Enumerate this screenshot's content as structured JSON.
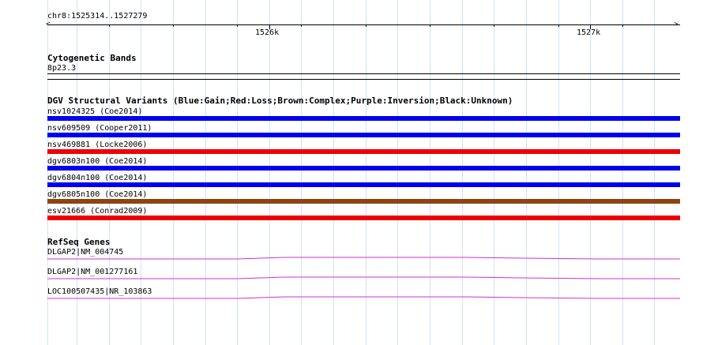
{
  "locus": "chr8:1525314..1527279",
  "ruler": {
    "labels": [
      "1526k",
      "1527k"
    ]
  },
  "cytoband": {
    "title": "Cytogenetic Bands",
    "band": "8p23.3"
  },
  "dgv": {
    "title": "DGV Structural Variants (Blue:Gain;Red:Loss;Brown:Complex;Purple:Inversion;Black:Unknown)",
    "colors": {
      "gain": "#0000ee",
      "loss": "#ee0000",
      "complex": "#8b4513"
    },
    "variants": [
      {
        "label": "nsv1024325 (Coe2014)",
        "type": "gain"
      },
      {
        "label": "nsv609509 (Cooper2011)",
        "type": "gain"
      },
      {
        "label": "nsv469881 (Locke2006)",
        "type": "loss"
      },
      {
        "label": "dgv6803n100 (Coe2014)",
        "type": "gain"
      },
      {
        "label": "dgv6804n100 (Coe2014)",
        "type": "gain"
      },
      {
        "label": "dgv6805n100 (Coe2014)",
        "type": "complex"
      },
      {
        "label": "esv21666 (Conrad2009)",
        "type": "loss"
      }
    ]
  },
  "refseq": {
    "title": "RefSeq Genes",
    "color": "#cc33cc",
    "genes": [
      {
        "label": "DLGAP2|NM_004745"
      },
      {
        "label": "DLGAP2|NM_001277161"
      },
      {
        "label": "LOC100507435|NR_103863"
      }
    ]
  }
}
